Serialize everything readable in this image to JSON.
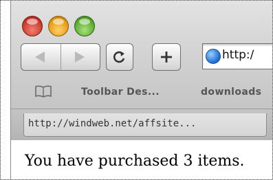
{
  "window": {
    "address_url": "http:/",
    "globe_icon": "globe-icon"
  },
  "toolbar": {
    "back_icon": "back-arrow-icon",
    "forward_icon": "forward-arrow-icon",
    "reload_icon": "reload-icon",
    "add_icon": "plus-icon"
  },
  "bookmarks": {
    "book_icon": "open-book-icon",
    "items": [
      {
        "label": "Toolbar Des..."
      },
      {
        "label": "downloads"
      }
    ]
  },
  "tabs": [
    {
      "label": "http://windweb.net/affsite..."
    }
  ],
  "content": {
    "message": "You have purchased 3 items."
  },
  "colors": {
    "close": "#c8372b",
    "minimize": "#e29a14",
    "zoom": "#5aa830"
  }
}
